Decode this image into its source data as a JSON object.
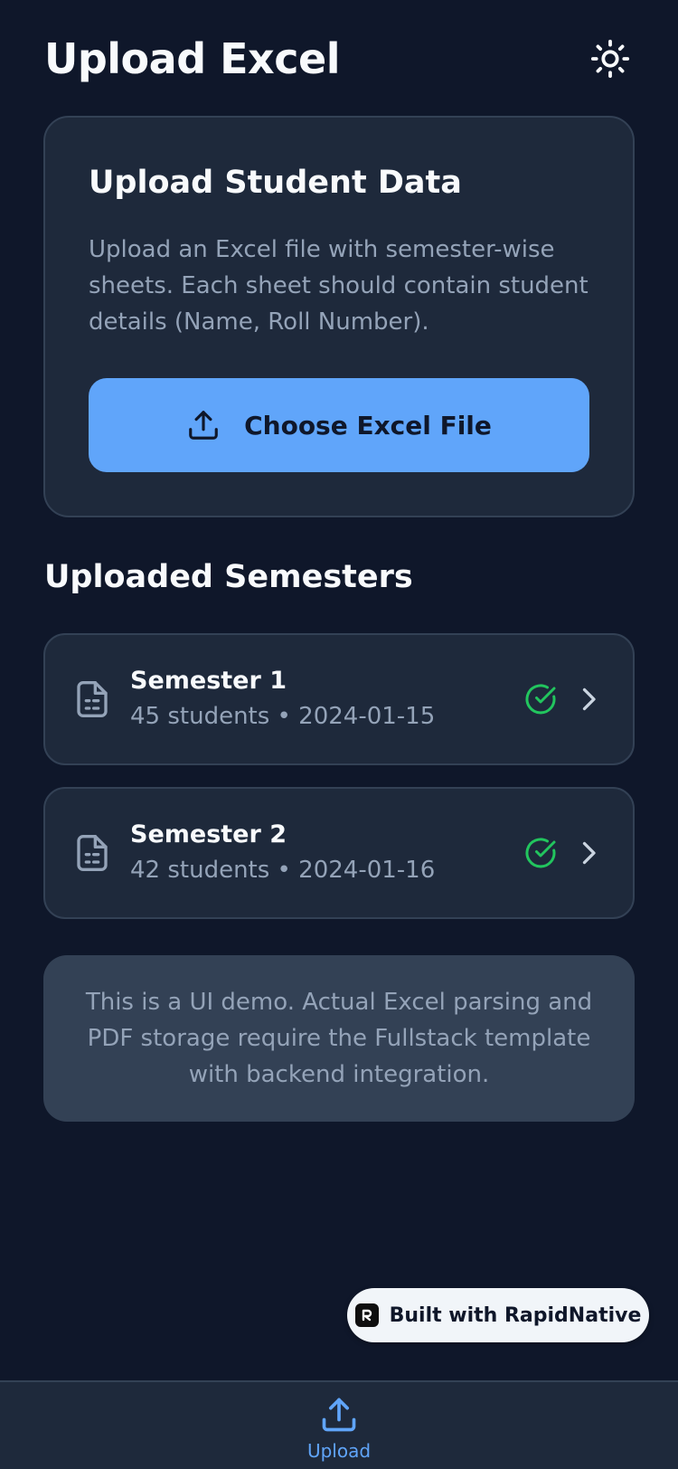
{
  "header": {
    "title": "Upload Excel",
    "theme_icon": "sun-icon"
  },
  "upload_card": {
    "title": "Upload Student Data",
    "description": "Upload an Excel file with semester-wise sheets. Each sheet should contain student details (Name, Roll Number).",
    "button_label": "Choose Excel File",
    "button_icon": "upload-icon"
  },
  "semesters": {
    "title": "Uploaded Semesters",
    "items": [
      {
        "name": "Semester 1",
        "meta": "45 students • 2024-01-15",
        "status_icon": "check-circle-icon"
      },
      {
        "name": "Semester 2",
        "meta": "42 students • 2024-01-16",
        "status_icon": "check-circle-icon"
      }
    ]
  },
  "note": {
    "text": "This is a UI demo. Actual Excel parsing and PDF storage require the Fullstack template with backend integration."
  },
  "badge": {
    "label": "Built with RapidNative"
  },
  "tabbar": {
    "upload_label": "Upload"
  },
  "colors": {
    "background": "#0f172a",
    "card": "#1e293b",
    "accent": "#60a5fa",
    "success": "#22c55e",
    "muted": "#94a3b8"
  }
}
